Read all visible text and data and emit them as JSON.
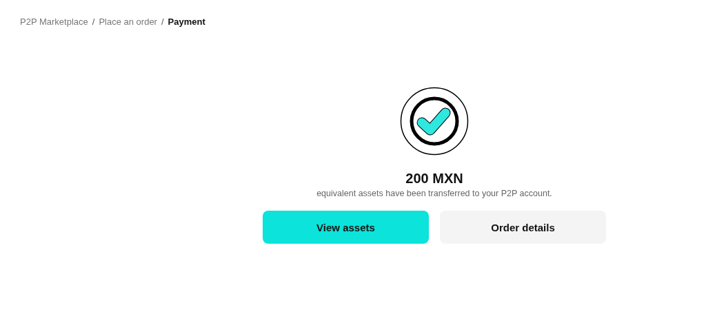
{
  "breadcrumb": [
    {
      "label": "P2P Marketplace",
      "current": false
    },
    {
      "label": "Place an order",
      "current": false
    },
    {
      "label": "Payment",
      "current": true
    }
  ],
  "separator": "/",
  "result": {
    "amount": "200 MXN",
    "message": "equivalent assets have been transferred to your P2P account."
  },
  "buttons": [
    {
      "label": "View assets",
      "kind": "primary"
    },
    {
      "label": "Order details",
      "kind": "secondary"
    }
  ]
}
